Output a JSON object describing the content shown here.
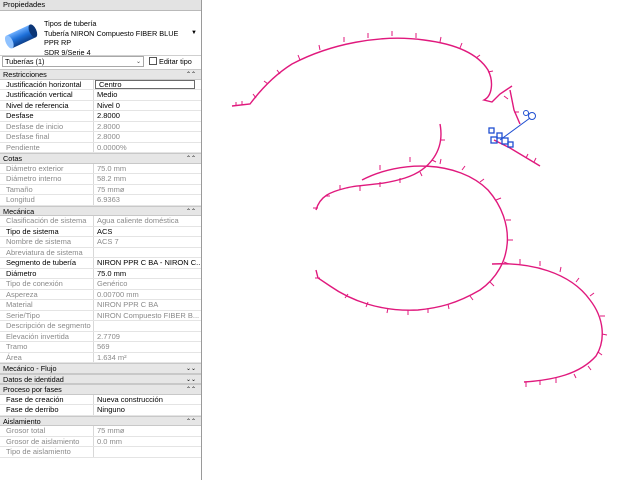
{
  "panel": {
    "title": "Propiedades"
  },
  "type_selector": {
    "line1": "Tipos de tubería",
    "line2": "Tubería NIRON Compuesto FIBER BLUE PPR RP",
    "line3": "SDR 9/Serie 4",
    "icon": "pipe-icon"
  },
  "instance": {
    "label": "Tuberías (1)",
    "edit_type": "Editar tipo"
  },
  "sections": [
    {
      "title": "Restricciones",
      "collapsed": false,
      "rows": [
        {
          "k": "Justificación horizontal",
          "v": "Centro",
          "ro": false,
          "edit": true
        },
        {
          "k": "Justificación vertical",
          "v": "Medio",
          "ro": false
        },
        {
          "k": "Nivel de referencia",
          "v": "Nivel 0",
          "ro": false
        },
        {
          "k": "Desfase",
          "v": "2.8000",
          "ro": false
        },
        {
          "k": "Desfase de inicio",
          "v": "2.8000",
          "ro": true
        },
        {
          "k": "Desfase final",
          "v": "2.8000",
          "ro": true
        },
        {
          "k": "Pendiente",
          "v": "0.0000%",
          "ro": true
        }
      ]
    },
    {
      "title": "Cotas",
      "collapsed": false,
      "rows": [
        {
          "k": "Diámetro exterior",
          "v": "75.0 mm",
          "ro": true
        },
        {
          "k": "Diámetro interno",
          "v": "58.2 mm",
          "ro": true
        },
        {
          "k": "Tamaño",
          "v": "75 mmø",
          "ro": true
        },
        {
          "k": "Longitud",
          "v": "6.9363",
          "ro": true
        }
      ]
    },
    {
      "title": "Mecánica",
      "collapsed": false,
      "rows": [
        {
          "k": "Clasificación de sistema",
          "v": "Agua caliente doméstica",
          "ro": true
        },
        {
          "k": "Tipo de sistema",
          "v": "ACS",
          "ro": false
        },
        {
          "k": "Nombre de sistema",
          "v": "ACS 7",
          "ro": true
        },
        {
          "k": "Abreviatura de sistema",
          "v": "",
          "ro": true
        },
        {
          "k": "Segmento de tubería",
          "v": "NIRON PPR C BA - NIRON C...",
          "ro": false
        },
        {
          "k": "Diámetro",
          "v": "75.0 mm",
          "ro": false
        },
        {
          "k": "Tipo de conexión",
          "v": "Genérico",
          "ro": true
        },
        {
          "k": "Aspereza",
          "v": "0.00700 mm",
          "ro": true
        },
        {
          "k": "Material",
          "v": "NIRON PPR C BA",
          "ro": true
        },
        {
          "k": "Serie/Tipo",
          "v": "NIRON Compuesto FIBER B...",
          "ro": true
        },
        {
          "k": "Descripción de segmento",
          "v": "",
          "ro": true
        },
        {
          "k": "Elevación invertida",
          "v": "2.7709",
          "ro": true
        },
        {
          "k": "Tramo",
          "v": "569",
          "ro": true
        },
        {
          "k": "Área",
          "v": "1.634 m²",
          "ro": true
        }
      ]
    },
    {
      "title": "Mecánico - Flujo",
      "collapsed": true,
      "rows": []
    },
    {
      "title": "Datos de identidad",
      "collapsed": true,
      "rows": []
    },
    {
      "title": "Proceso por fases",
      "collapsed": false,
      "rows": [
        {
          "k": "Fase de creación",
          "v": "Nueva construcción",
          "ro": false
        },
        {
          "k": "Fase de derribo",
          "v": "Ninguno",
          "ro": false
        }
      ]
    },
    {
      "title": "Aislamiento",
      "collapsed": false,
      "rows": [
        {
          "k": "Grosor total",
          "v": "75 mmø",
          "ro": true
        },
        {
          "k": "Grosor de aislamiento",
          "v": "0.0 mm",
          "ro": true
        },
        {
          "k": "Tipo de aislamiento",
          "v": "",
          "ro": true
        }
      ]
    }
  ],
  "drawing": {
    "pipe_color": "#e0197d",
    "selection_color": "#1f4fd1"
  }
}
